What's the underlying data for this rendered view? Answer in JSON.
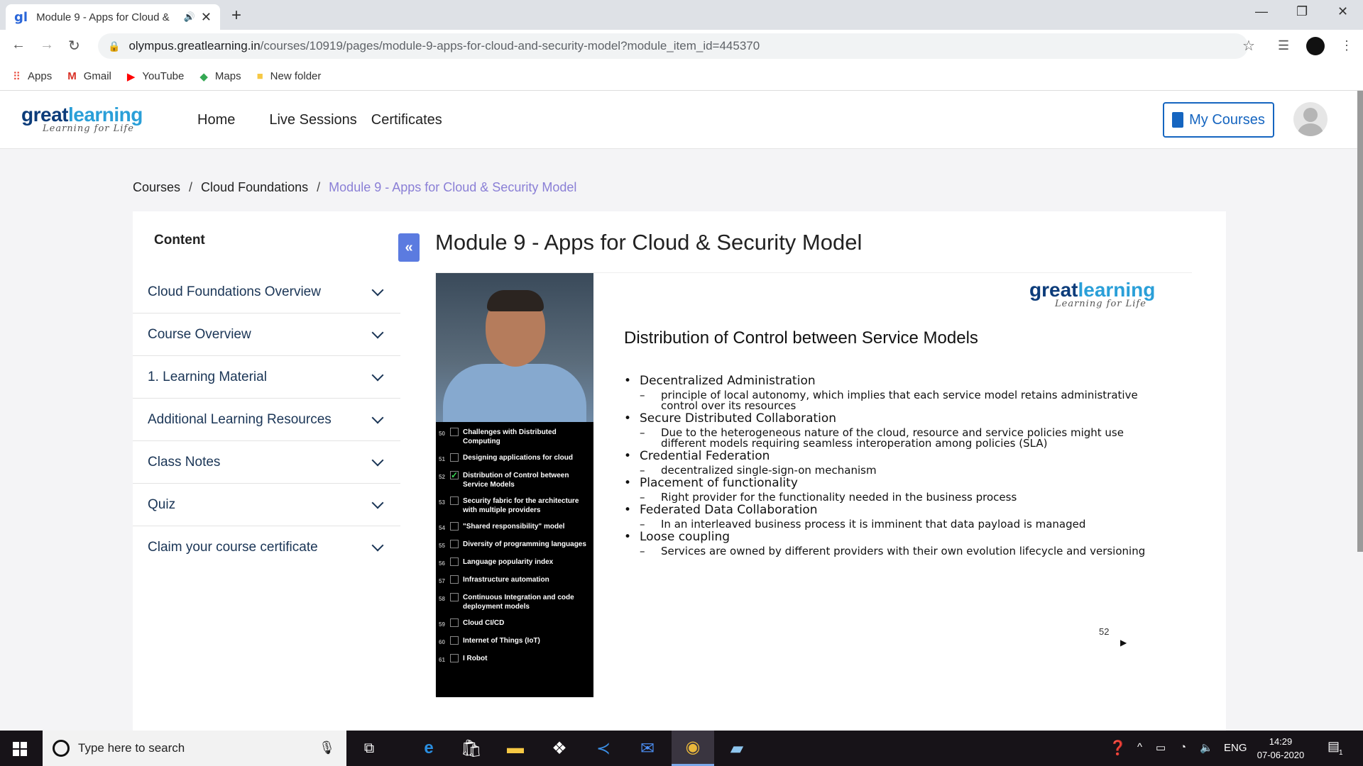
{
  "browser": {
    "tab_title": "Module 9 - Apps for Cloud &",
    "tab_favicon": "gl",
    "url_host": "olympus.greatlearning.in",
    "url_path": "/courses/10919/pages/module-9-apps-for-cloud-and-security-model?module_item_id=445370",
    "bookmarks": [
      {
        "label": "Apps",
        "icon": "apps-grid-icon"
      },
      {
        "label": "Gmail",
        "icon": "gmail-icon"
      },
      {
        "label": "YouTube",
        "icon": "youtube-icon"
      },
      {
        "label": "Maps",
        "icon": "maps-icon"
      },
      {
        "label": "New folder",
        "icon": "folder-icon"
      }
    ]
  },
  "site": {
    "logo_word1": "great",
    "logo_word2": "learning",
    "logo_tagline": "Learning for Life",
    "nav": [
      "Home",
      "Live Sessions",
      "Certificates"
    ],
    "my_courses_label": "My Courses"
  },
  "breadcrumb": {
    "items": [
      "Courses",
      "Cloud Foundations"
    ],
    "separator": "/",
    "current": "Module 9 - Apps for Cloud & Security Model"
  },
  "sidebar": {
    "heading": "Content",
    "collapse_glyph": "«",
    "items": [
      {
        "label": "Cloud Foundations Overview"
      },
      {
        "label": "Course Overview"
      },
      {
        "label": "1. Learning Material"
      },
      {
        "label": "Additional Learning Resources"
      },
      {
        "label": "Class Notes"
      },
      {
        "label": "Quiz"
      },
      {
        "label": "Claim your course certificate"
      }
    ]
  },
  "main": {
    "title": "Module 9 - Apps for Cloud & Security Model",
    "video": {
      "toc": [
        {
          "num": "50",
          "text": "Challenges with Distributed Computing",
          "checked": false
        },
        {
          "num": "51",
          "text": "Designing applications for cloud",
          "checked": false
        },
        {
          "num": "52",
          "text": "Distribution of Control between Service Models",
          "checked": true
        },
        {
          "num": "53",
          "text": "Security fabric for the architecture with multiple providers",
          "checked": false
        },
        {
          "num": "54",
          "text": "\"Shared responsibility\" model",
          "checked": false
        },
        {
          "num": "55",
          "text": "Diversity of programming languages",
          "checked": false
        },
        {
          "num": "56",
          "text": "Language popularity index",
          "checked": false
        },
        {
          "num": "57",
          "text": "Infrastructure automation",
          "checked": false
        },
        {
          "num": "58",
          "text": "Continuous Integration and code deployment models",
          "checked": false
        },
        {
          "num": "59",
          "text": "Cloud CI/CD",
          "checked": false
        },
        {
          "num": "60",
          "text": "Internet of Things (IoT)",
          "checked": false
        },
        {
          "num": "61",
          "text": "I Robot",
          "checked": false
        }
      ],
      "slide": {
        "logo_word1": "great",
        "logo_word2": "learning",
        "logo_tagline": "Learning for Life",
        "title": "Distribution of Control between Service Models",
        "bullets": [
          {
            "text": "Decentralized Administration",
            "sub": "principle of local autonomy, which implies that each service model retains administrative control over its resources"
          },
          {
            "text": "Secure Distributed Collaboration",
            "sub": "Due to the heterogeneous nature of the cloud, resource and service policies might use different models requiring seamless interoperation among policies (SLA)"
          },
          {
            "text": "Credential Federation",
            "sub": "decentralized single-sign-on mechanism"
          },
          {
            "text": "Placement of functionality",
            "sub": "Right provider for the functionality needed in the business process"
          },
          {
            "text": "Federated Data Collaboration",
            "sub": "In an interleaved business process it is imminent that data payload is managed"
          },
          {
            "text": "Loose coupling",
            "sub": "Services are owned by different providers with their own evolution lifecycle and versioning"
          }
        ],
        "slide_number": "52",
        "play_glyph": "▶"
      }
    }
  },
  "taskbar": {
    "search_placeholder": "Type here to search",
    "language": "ENG",
    "time": "14:29",
    "date": "07-06-2020",
    "notification_count": "1"
  }
}
